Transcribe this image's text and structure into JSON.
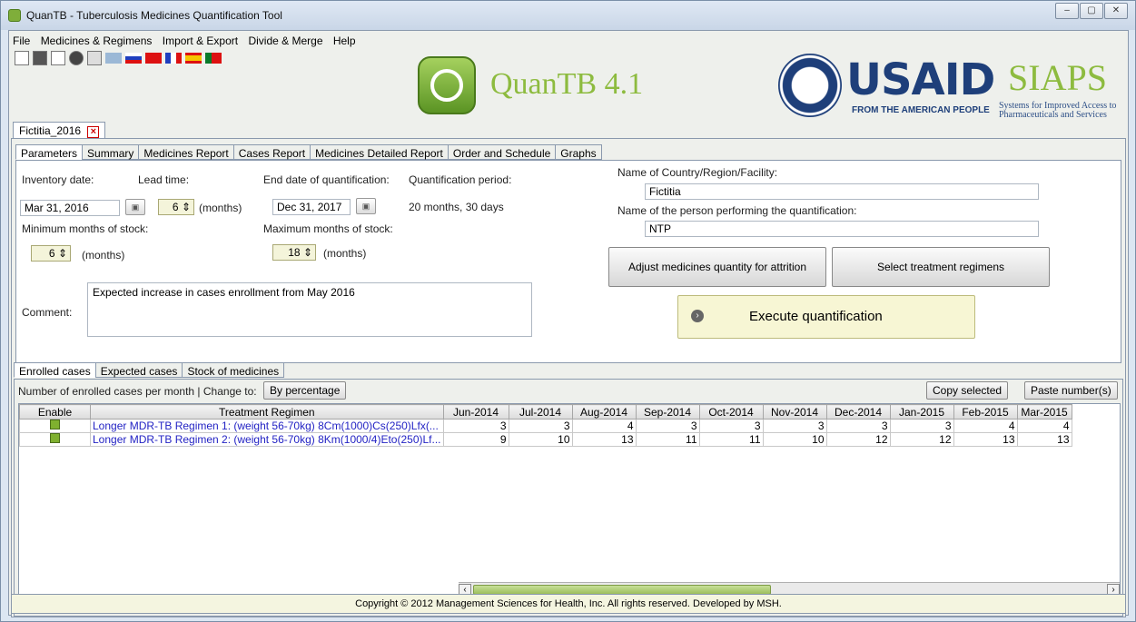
{
  "window": {
    "title": "QuanTB - Tuberculosis Medicines Quantification Tool",
    "controls": [
      "–",
      "▢",
      "✕"
    ]
  },
  "menu": [
    "File",
    "Medicines & Regimens",
    "Import & Export",
    "Divide & Merge",
    "Help"
  ],
  "toolbar_icons": [
    "new-file-icon",
    "open-folder-icon",
    "save-icon",
    "arrow-icon",
    "print-icon",
    "flag-en-icon",
    "flag-ru-icon",
    "flag-cn-icon",
    "flag-fr-icon",
    "flag-es-icon",
    "flag-pt-icon"
  ],
  "branding": {
    "app_name": "QuanTB 4.1",
    "usaid": "USAID",
    "usaid_sub": "FROM THE AMERICAN PEOPLE",
    "siaps": "SIAPS",
    "siaps_sub": "Systems for Improved Access to Pharmaceuticals and Services"
  },
  "document_tab": "Fictitia_2016",
  "main_tabs": [
    "Parameters",
    "Summary",
    "Medicines Report",
    "Cases Report",
    "Medicines Detailed Report",
    "Order and Schedule",
    "Graphs"
  ],
  "parameters": {
    "inventory_date_label": "Inventory date:",
    "inventory_date": "Mar 31, 2016",
    "lead_time_label": "Lead time:",
    "lead_time": "6",
    "months_unit": "(months)",
    "end_date_label": "End date of quantification:",
    "end_date": "Dec 31, 2017",
    "period_label": "Quantification period:",
    "period_value": "20 months, 30 days",
    "min_stock_label": "Minimum months of stock:",
    "min_stock": "6",
    "max_stock_label": "Maximum months of stock:",
    "max_stock": "18",
    "country_label": "Name of Country/Region/Facility:",
    "country": "Fictitia",
    "person_label": "Name of the person performing the quantification:",
    "person": "NTP",
    "adjust_btn": "Adjust medicines quantity for attrition",
    "regimens_btn": "Select treatment regimens",
    "execute_btn": "Execute quantification",
    "comment_label": "Comment:",
    "comment": "Expected increase in cases enrollment from May 2016"
  },
  "sub_tabs": [
    "Enrolled cases",
    "Expected cases",
    "Stock of medicines"
  ],
  "enrolled": {
    "desc": "Number of enrolled cases per month | Change to:",
    "change_btn": "By percentage",
    "copy_btn": "Copy selected",
    "paste_btn": "Paste number(s)",
    "columns": [
      "Enable",
      "Treatment Regimen",
      "Jun-2014",
      "Jul-2014",
      "Aug-2014",
      "Sep-2014",
      "Oct-2014",
      "Nov-2014",
      "Dec-2014",
      "Jan-2015",
      "Feb-2015",
      "Mar-2015"
    ],
    "rows": [
      {
        "regimen": "Longer MDR-TB Regimen 1: (weight 56-70kg)  8Cm(1000)Cs(250)Lfx(...",
        "values": [
          "3",
          "3",
          "4",
          "3",
          "3",
          "3",
          "3",
          "3",
          "4",
          "4"
        ]
      },
      {
        "regimen": "Longer MDR-TB Regimen 2: (weight 56-70kg)  8Km(1000/4)Eto(250)Lf...",
        "values": [
          "9",
          "10",
          "13",
          "11",
          "11",
          "10",
          "12",
          "12",
          "13",
          "13"
        ]
      }
    ]
  },
  "footer": "Copyright © 2012 Management Sciences for Health, Inc. All rights reserved. Developed by MSH."
}
